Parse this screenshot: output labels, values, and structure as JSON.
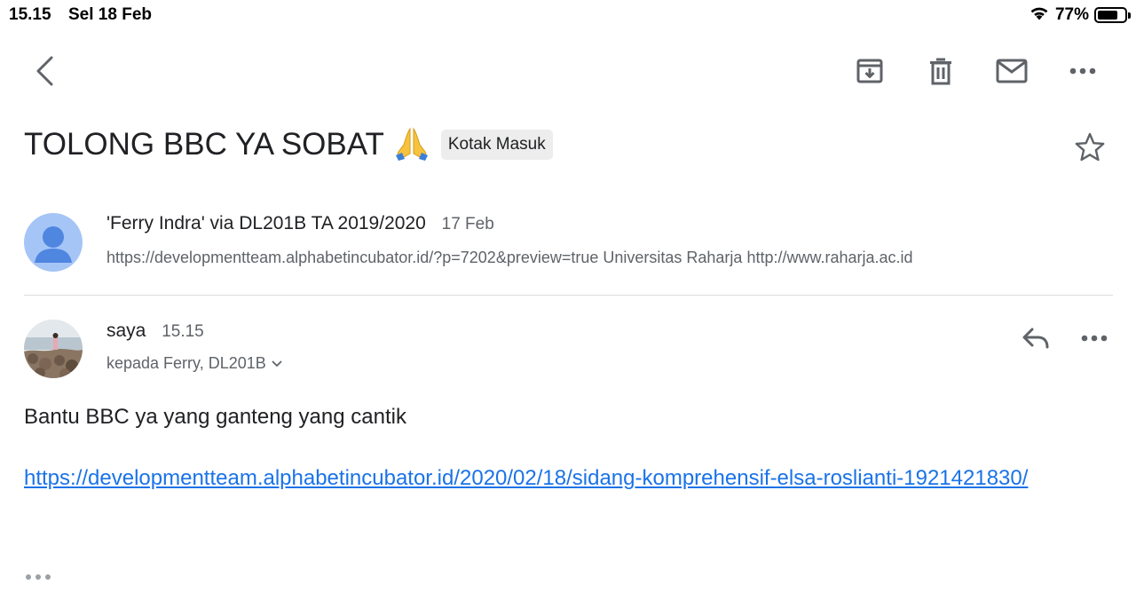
{
  "status_bar": {
    "time": "15.15",
    "date": "Sel 18 Feb",
    "battery_percent": "77%",
    "battery_level": 0.77
  },
  "toolbar": {
    "back_icon": "chevron-left-icon",
    "archive_icon": "archive-icon",
    "delete_icon": "trash-icon",
    "mark_unread_icon": "mail-icon",
    "more_icon": "more-horiz-icon"
  },
  "subject": {
    "title": "TOLONG BBC YA SOBAT",
    "emoji": "🙏",
    "label": "Kotak Masuk",
    "star_icon": "star-outline-icon"
  },
  "messages": [
    {
      "sender": "'Ferry Indra' via DL201B TA 2019/2020",
      "date": "17 Feb",
      "snippet": "https://developmentteam.alphabetincubator.id/?p=7202&preview=true Universitas Raharja http://www.raharja.ac.id",
      "avatar": "default-person-avatar"
    },
    {
      "sender": "saya",
      "time": "15.15",
      "recipients": "kepada Ferry, DL201B",
      "avatar": "photo-avatar",
      "body_text": "Bantu BBC ya yang ganteng yang cantik",
      "body_link": "https://developmentteam.alphabetincubator.id/2020/02/18/sidang-komprehensif-elsa-roslianti-1921421830/"
    }
  ],
  "colors": {
    "link": "#1a73e8",
    "avatar_bg": "#a6c5f7",
    "avatar_fg": "#4f86e0",
    "icon": "#5f6368"
  }
}
